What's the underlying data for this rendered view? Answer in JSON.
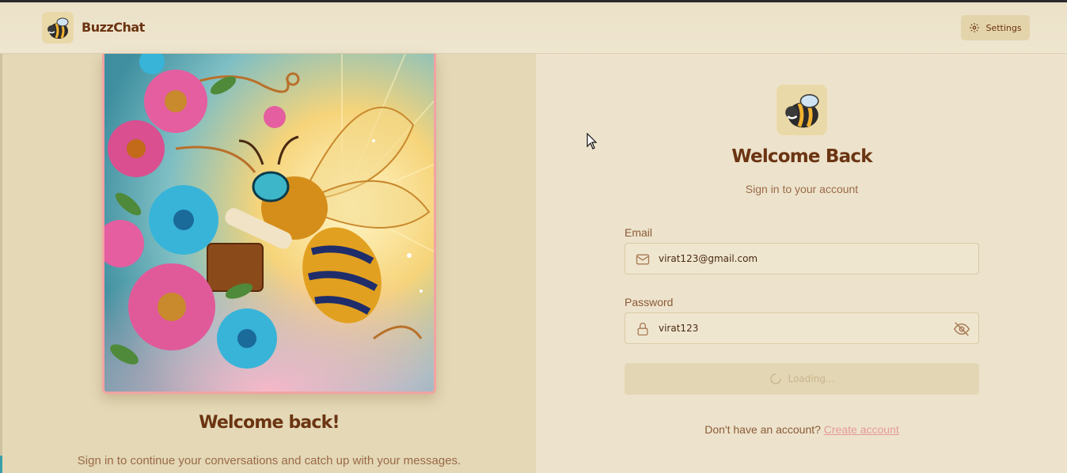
{
  "header": {
    "brand": "BuzzChat",
    "settings_label": "Settings"
  },
  "left_panel": {
    "title": "Welcome back!",
    "subtitle": "Sign in to continue your conversations and catch up with your messages."
  },
  "form": {
    "title": "Welcome Back",
    "subtitle": "Sign in to your account",
    "email_label": "Email",
    "email_value": "virat123@gmail.com",
    "password_label": "Password",
    "password_value": "virat123",
    "submit_label": "Loading...",
    "signup_prompt": "Don't have an account?",
    "signup_link": "Create account"
  },
  "icons": {
    "logo": "bee-icon",
    "settings": "gear-icon",
    "email": "mail-icon",
    "password": "lock-icon",
    "toggle": "eye-off-icon",
    "spinner": "spinner-icon"
  },
  "colors": {
    "brand": "#6b3412",
    "background": "#ede3cc",
    "accent_link": "#e59a9a",
    "frame": "#f2a3a3"
  }
}
